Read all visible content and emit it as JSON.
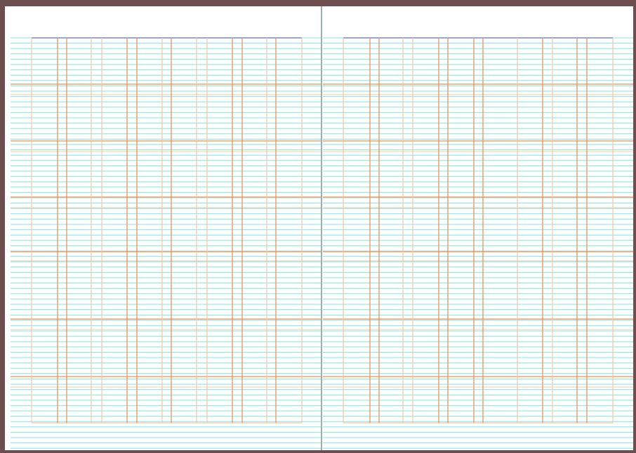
{
  "colors": {
    "frame": "#6e4f4f",
    "paper": "#ffffff",
    "rule_line": "#7fe6e6",
    "major_horizontal": "#f0a070",
    "minor_horizontal": "#f5c8a8",
    "vertical_dark": "#e8925a",
    "vertical_light": "#f3c49c",
    "top_edge": "#7a86d6",
    "spine": "#5a7a7a"
  },
  "ledger": {
    "pages": [
      "left-page",
      "right-page"
    ],
    "printed_text": []
  }
}
